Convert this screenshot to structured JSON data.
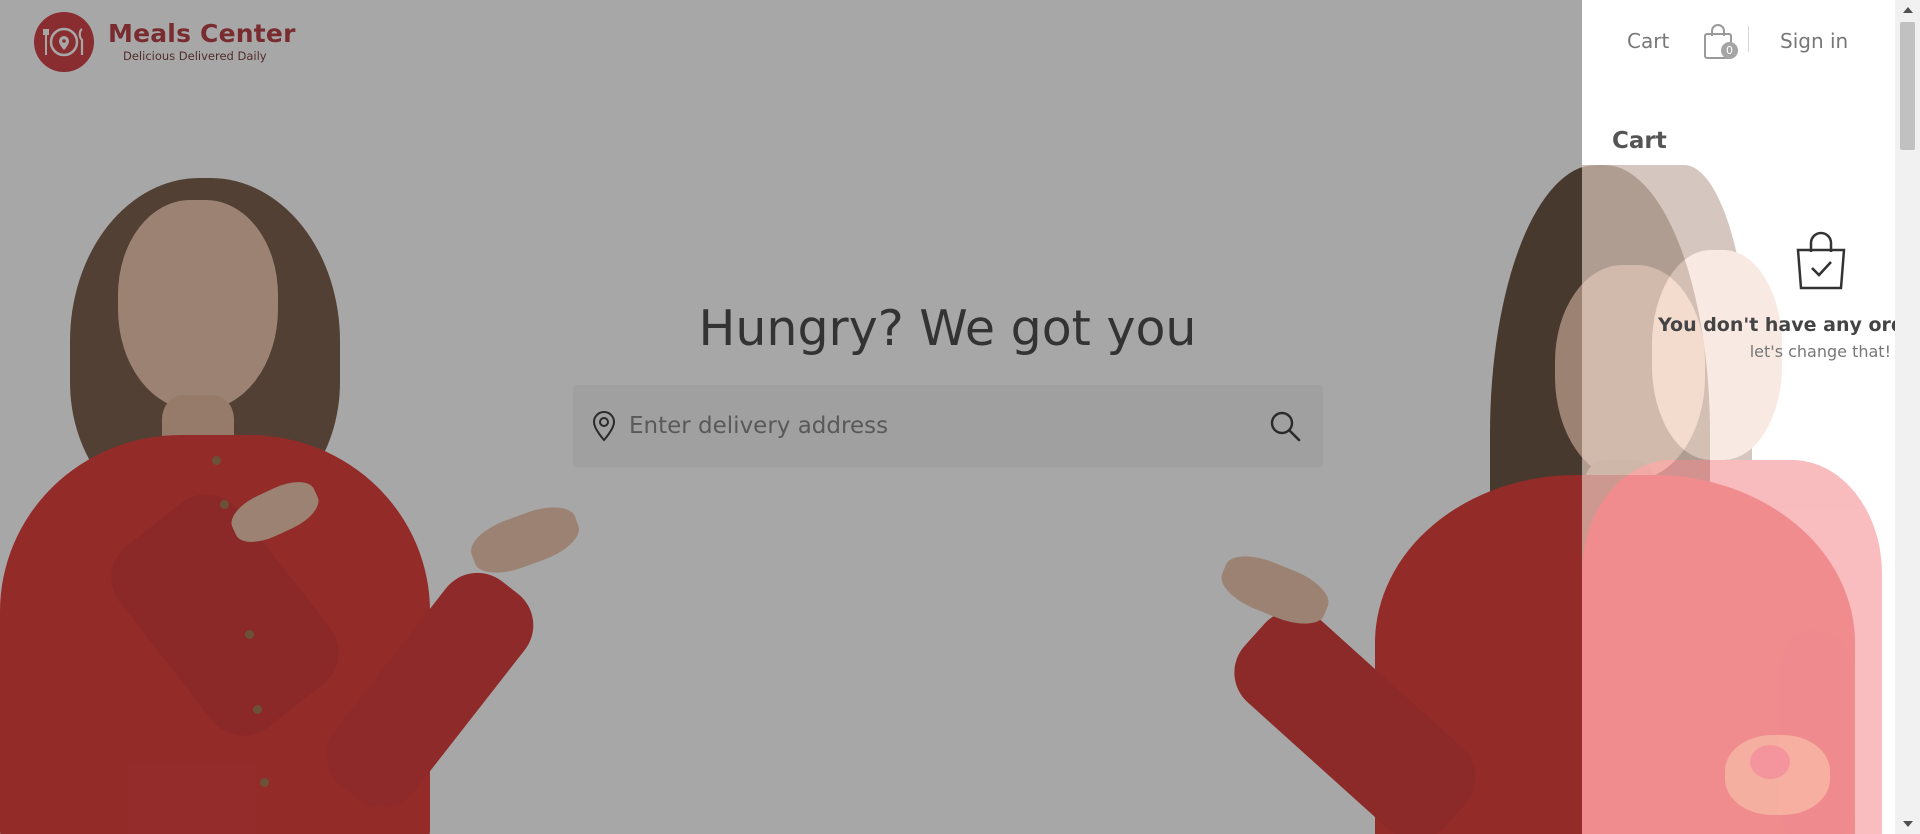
{
  "brand": {
    "name": "Meals Center",
    "tagline": "Delicious Delivered Daily",
    "accent_color": "#c8161d"
  },
  "hero": {
    "title": "Hungry? We got you",
    "search": {
      "placeholder": "Enter delivery address",
      "value": "",
      "pin_icon": "location-pin-icon",
      "search_icon": "search-icon"
    }
  },
  "drawer": {
    "cart_link": "Cart",
    "cart_count": "0",
    "sign_in": "Sign in",
    "title": "Cart",
    "empty_title": "You don't have any ord",
    "empty_subtitle": "let's change that!",
    "empty_icon": "shopping-bag-check-icon"
  },
  "colors": {
    "shirt_red": "#d8120f",
    "overlay": "rgba(72,72,72,0.48)"
  }
}
